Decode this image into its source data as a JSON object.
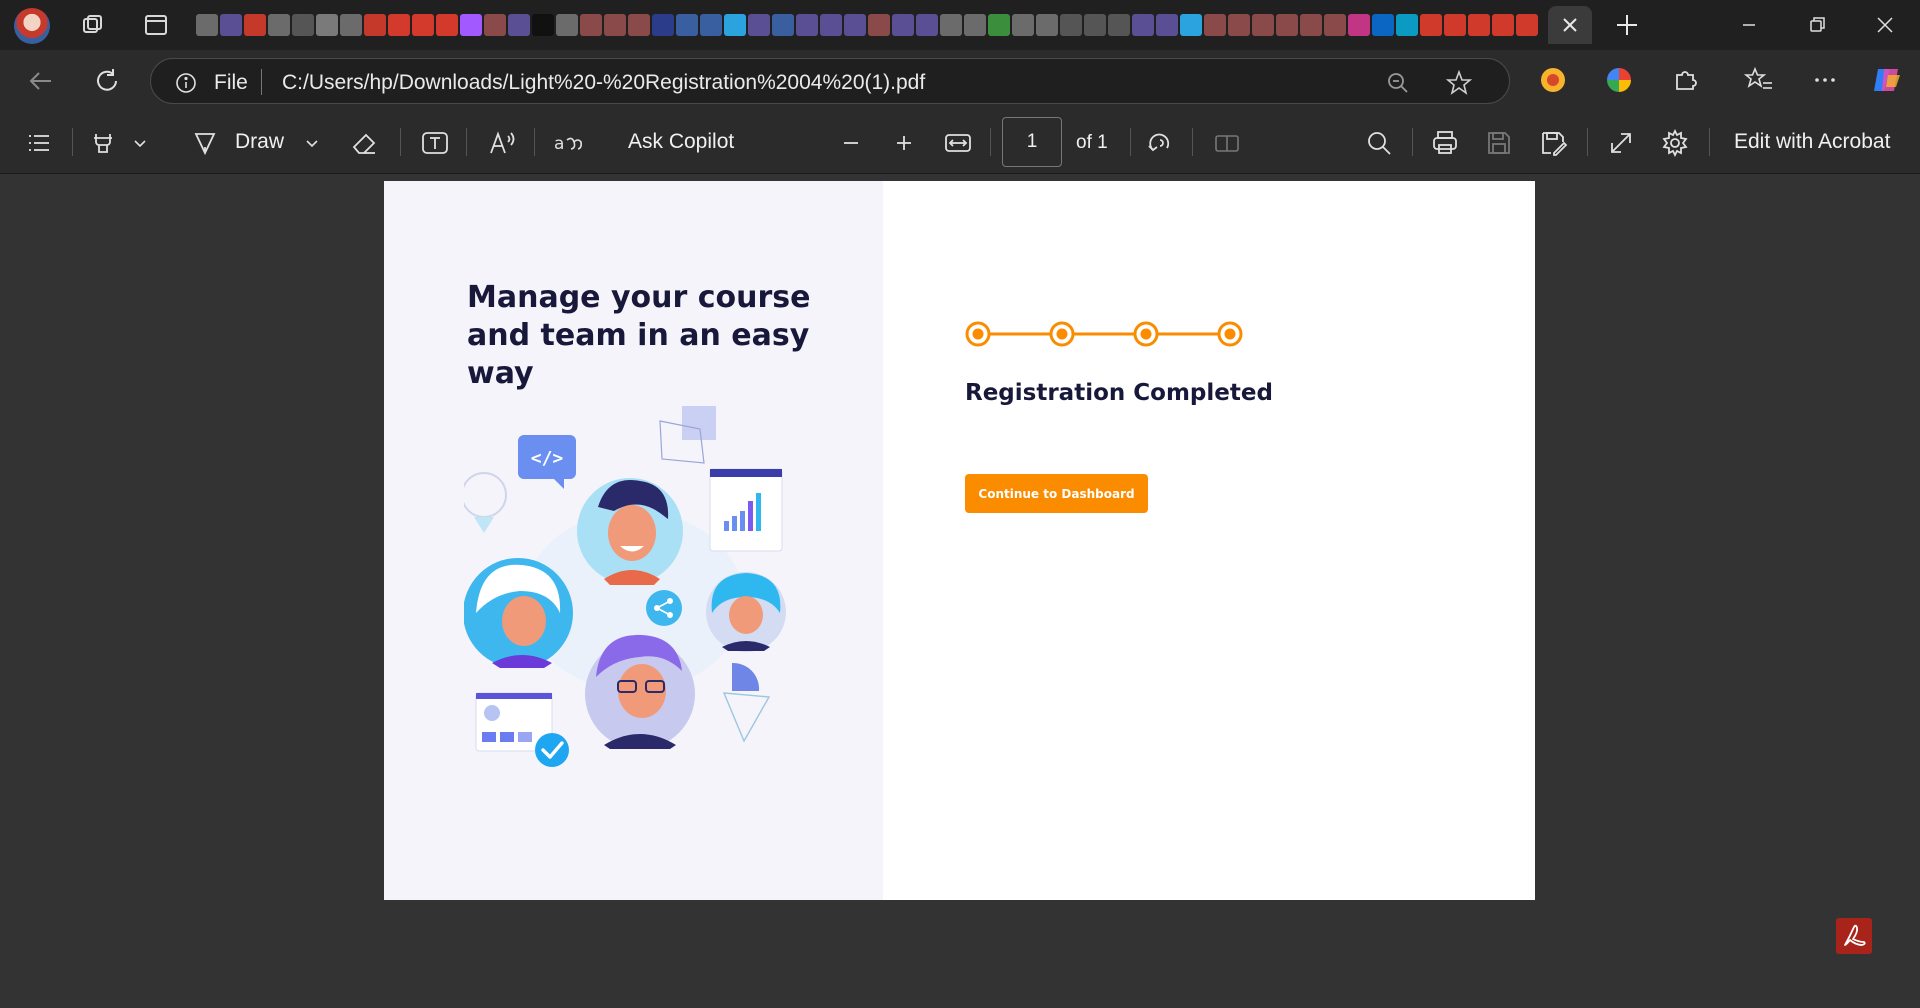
{
  "browser": {
    "address": {
      "scheme_label": "File",
      "url": "C:/Users/hp/Downloads/Light%20-%20Registration%2004%20(1).pdf"
    }
  },
  "pdf_toolbar": {
    "draw_label": "Draw",
    "ask_copilot_label": "Ask Copilot",
    "page_current": "1",
    "page_total": "of 1",
    "edit_with_acrobat_label": "Edit with Acrobat"
  },
  "document": {
    "headline": "Manage your course and team in an easy way",
    "registration_title": "Registration Completed",
    "cta_label": "Continue to Dashboard",
    "steps_completed": 4,
    "steps_total": 4,
    "accent_color": "#fb8c00",
    "illustration_code_tag": "</>"
  },
  "colors": {
    "chrome_bg": "#202020",
    "toolbar_bg": "#2b2b2b",
    "viewer_bg": "#333333",
    "accent": "#fb8c00",
    "heading": "#18183a"
  }
}
